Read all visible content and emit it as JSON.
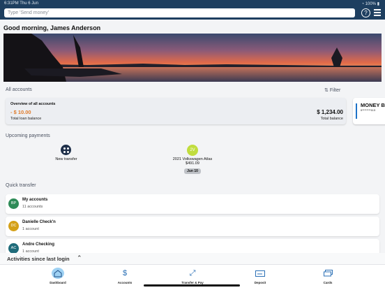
{
  "status": {
    "time_date": "6:31PM  Thu 6 Jun",
    "battery": "100%"
  },
  "search": {
    "placeholder": "Type 'Send money'"
  },
  "greeting": "Good morning,  James Anderson",
  "all_accounts": {
    "label": "All accounts",
    "filter_label": "Filter"
  },
  "overview": {
    "title": "Overview of all accounts",
    "loan_amount": "- $ 10.00",
    "loan_label": "Total loan balance",
    "balance_amount": "$ 1,234.00",
    "balance_label": "Total balance"
  },
  "money_card": {
    "title": "MONEY B",
    "number": "0********113"
  },
  "upcoming": {
    "label": "Upcoming payments",
    "new_transfer": "New transfer",
    "payment": {
      "initials": "2V",
      "name": "2021 Volkswagen Atlas",
      "amount": "$491.09",
      "date": "Jun 10"
    }
  },
  "quick_transfer": {
    "label": "Quick transfer",
    "items": [
      {
        "initials": "BP",
        "name": "My accounts",
        "count": "11 accounts",
        "color": "#2e8b57"
      },
      {
        "initials": "DC",
        "name": "Danielle Check'n",
        "count": "1 account",
        "color": "#d4a017"
      },
      {
        "initials": "AC",
        "name": "Andre Checking",
        "count": "1 account",
        "color": "#1e6b7a"
      }
    ]
  },
  "activities": {
    "label": "Activities since last login"
  },
  "nav": {
    "items": [
      {
        "label": "Dashboard",
        "icon": "home-icon"
      },
      {
        "label": "Accounts",
        "icon": "dollar-icon"
      },
      {
        "label": "Transfer & Pay",
        "icon": "transfer-icon"
      },
      {
        "label": "Deposit",
        "icon": "check-deposit-icon"
      },
      {
        "label": "Cards",
        "icon": "cards-icon"
      }
    ]
  },
  "colors": {
    "header": "#1e3f60",
    "accent": "#1e73c8",
    "loan": "#e07b2a"
  }
}
